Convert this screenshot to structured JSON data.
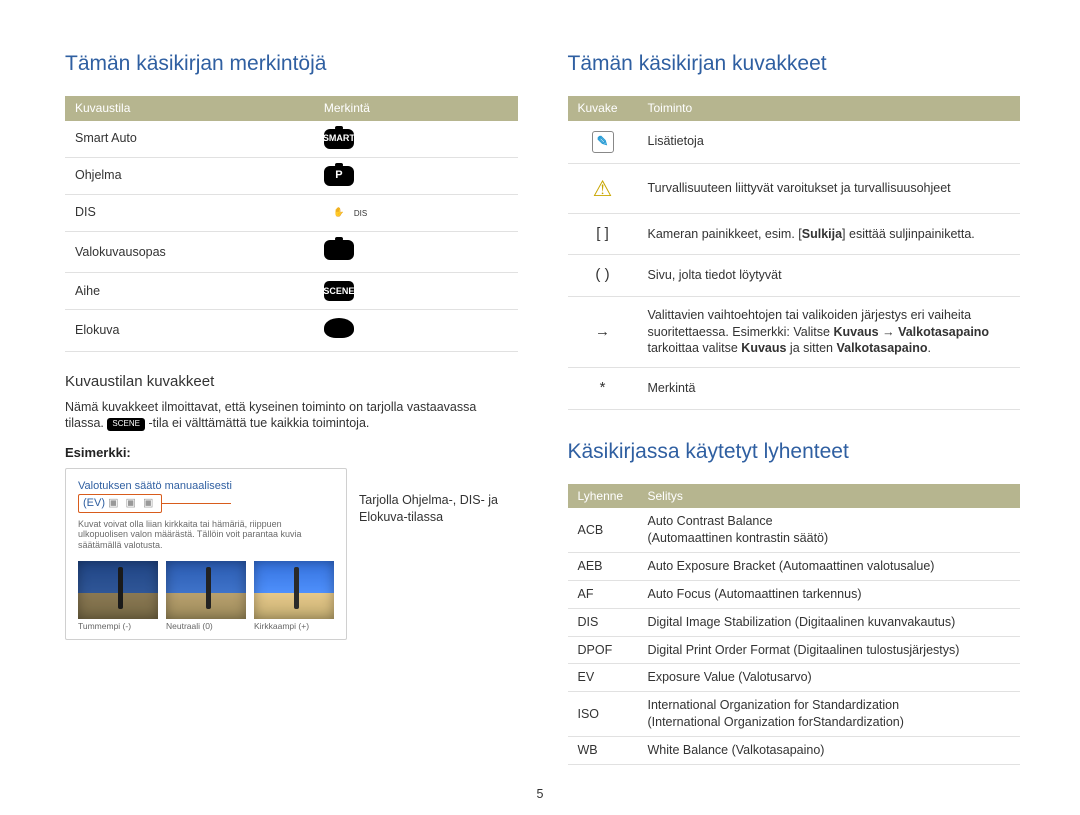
{
  "page_number": "5",
  "left": {
    "heading": "Tämän käsikirjan merkintöjä",
    "table1": {
      "headers": [
        "Kuvaustila",
        "Merkintä"
      ],
      "rows": [
        {
          "mode": "Smart Auto",
          "icon_label": "SMART",
          "icon_key": "smart-auto-cam-icon"
        },
        {
          "mode": "Ohjelma",
          "icon_label": "P",
          "icon_key": "program-cam-icon"
        },
        {
          "mode": "DIS",
          "icon_label": "DIS",
          "icon_key": "dis-hand-icon"
        },
        {
          "mode": "Valokuvausopas",
          "icon_label": "",
          "icon_key": "photoguide-cam-icon"
        },
        {
          "mode": "Aihe",
          "icon_label": "SCENE",
          "icon_key": "scene-clapper-icon"
        },
        {
          "mode": "Elokuva",
          "icon_label": "",
          "icon_key": "movie-cam-icon"
        }
      ]
    },
    "sub_heading": "Kuvaustilan kuvakkeet",
    "sub_para1": "Nämä kuvakkeet ilmoittavat, että kyseinen toiminto on tarjolla vastaavassa tilassa.",
    "sub_para_chip": "SCENE",
    "sub_para2": "-tila ei välttämättä tue kaikkia toimintoja.",
    "example_label": "Esimerkki:",
    "example": {
      "title_line1": "Valotuksen säätö manuaalisesti",
      "title_line2_prefix": "(EV)",
      "note": "Kuvat voivat olla liian kirkkaita tai hämäriä, riippuen ulkopuolisen valon määrästä. Tällöin voit parantaa kuvia säätämällä valotusta.",
      "thumbs": [
        {
          "label": "Tummempi (-)"
        },
        {
          "label": "Neutraali (0)"
        },
        {
          "label": "Kirkkaampi (+)"
        }
      ]
    },
    "callout": "Tarjolla Ohjelma-, DIS- ja Elokuva-tilassa"
  },
  "right": {
    "heading1": "Tämän käsikirjan kuvakkeet",
    "table2": {
      "headers": [
        "Kuvake",
        "Toiminto"
      ],
      "rows": [
        {
          "sym_kind": "note",
          "text": "Lisätietoja"
        },
        {
          "sym_kind": "warn",
          "text": "Turvallisuuteen liittyvät varoitukset ja turvallisuusohjeet"
        },
        {
          "sym_kind": "brackets",
          "text": "Kameran painikkeet, esim. [<b>Sulkija</b>] esittää suljinpainiketta."
        },
        {
          "sym_kind": "paren",
          "text": "Sivu, jolta tiedot löytyvät"
        },
        {
          "sym_kind": "arrow",
          "text": "Valittavien vaihtoehtojen tai valikoiden järjestys eri vaiheita suoritettaessa. Esimerkki: Valitse <b>Kuvaus</b> → <b>Valkotasapaino</b> tarkoittaa valitse <b>Kuvaus</b> ja sitten <b>Valkotasapaino</b>."
        },
        {
          "sym_kind": "asterisk",
          "text": "Merkintä"
        }
      ]
    },
    "heading2": "Käsikirjassa käytetyt lyhenteet",
    "table3": {
      "headers": [
        "Lyhenne",
        "Selitys"
      ],
      "rows": [
        {
          "abbr": "ACB",
          "text": "Auto Contrast Balance<br>(Automaattinen kontrastin säätö)"
        },
        {
          "abbr": "AEB",
          "text": "Auto Exposure Bracket (Automaattinen valotusalue)"
        },
        {
          "abbr": "AF",
          "text": "Auto Focus (Automaattinen tarkennus)"
        },
        {
          "abbr": "DIS",
          "text": "Digital Image Stabilization (Digitaalinen kuvanvakautus)"
        },
        {
          "abbr": "DPOF",
          "text": "Digital Print Order Format (Digitaalinen tulostusjärjestys)"
        },
        {
          "abbr": "EV",
          "text": "Exposure Value (Valotusarvo)"
        },
        {
          "abbr": "ISO",
          "text": "International Organization for Standardization<br>(International Organization forStandardization)"
        },
        {
          "abbr": "WB",
          "text": "White Balance (Valkotasapaino)"
        }
      ]
    }
  }
}
